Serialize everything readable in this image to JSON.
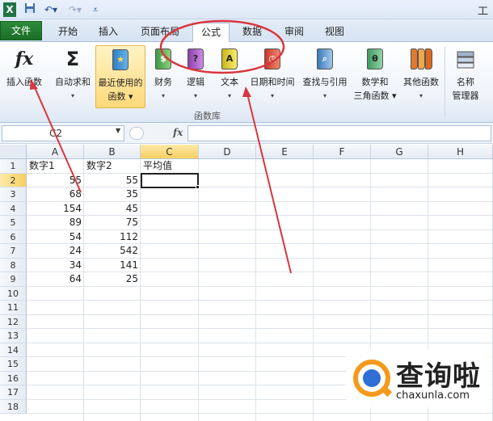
{
  "app": {
    "title": "工"
  },
  "qat": {
    "save_icon": "save-icon",
    "undo_icon": "undo-icon",
    "redo_icon": "redo-icon"
  },
  "tabs": [
    {
      "label": "文件"
    },
    {
      "label": "开始"
    },
    {
      "label": "插入"
    },
    {
      "label": "页面布局"
    },
    {
      "label": "公式"
    },
    {
      "label": "数据"
    },
    {
      "label": "审阅"
    },
    {
      "label": "视图"
    }
  ],
  "ribbon": {
    "insert_function": {
      "label": "插入函数",
      "icon": "fx"
    },
    "autosum": {
      "label": "自动求和",
      "icon": "Σ"
    },
    "recent": {
      "label": "最近使用的",
      "label2": "函数"
    },
    "finance": {
      "label": "财务"
    },
    "logic": {
      "label": "逻辑"
    },
    "text": {
      "label": "文本"
    },
    "datetime": {
      "label": "日期和时间"
    },
    "lookup": {
      "label": "查找与引用"
    },
    "math": {
      "label": "数学和",
      "label2": "三角函数"
    },
    "other": {
      "label": "其他函数"
    },
    "name_manager": {
      "label": "名称",
      "label2": "管理器"
    },
    "group_label": "函数库"
  },
  "formula_bar": {
    "name_box": "C2",
    "fx": "fx",
    "value": ""
  },
  "sheet": {
    "columns": [
      "A",
      "B",
      "C",
      "D",
      "E",
      "F",
      "G",
      "H"
    ],
    "rows": [
      "1",
      "2",
      "3",
      "4",
      "5",
      "6",
      "7",
      "8",
      "9",
      "10",
      "11",
      "12",
      "13",
      "14",
      "15",
      "16",
      "17",
      "18"
    ],
    "header": [
      "数字1",
      "数字2",
      "平均值"
    ],
    "data": [
      [
        "55",
        "55"
      ],
      [
        "68",
        "35"
      ],
      [
        "154",
        "45"
      ],
      [
        "89",
        "75"
      ],
      [
        "54",
        "112"
      ],
      [
        "24",
        "542"
      ],
      [
        "34",
        "141"
      ],
      [
        "64",
        "25"
      ]
    ],
    "selected_cell": "C2"
  },
  "watermark": {
    "text": "查询啦",
    "url": "chaxunla.com"
  },
  "colors": {
    "annotation": "#d9363e",
    "file_tab": "#1b6e27",
    "selection": "#f7cf5f"
  }
}
